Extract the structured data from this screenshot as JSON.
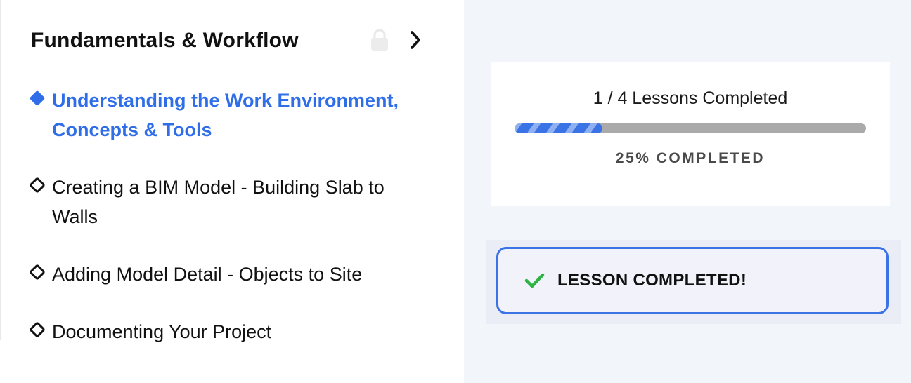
{
  "module": {
    "title": "Fundamentals & Workflow",
    "lock_icon": "lock-icon",
    "next_icon": "chevron-right-icon"
  },
  "lessons": [
    {
      "lines": [
        "Understanding the Work Environment,",
        "Concepts & Tools"
      ],
      "state": "active"
    },
    {
      "lines": [
        "Creating a BIM Model - Building Slab to",
        "Walls"
      ],
      "state": "incomplete"
    },
    {
      "lines": [
        "Adding Model Detail - Objects to Site"
      ],
      "state": "incomplete"
    },
    {
      "lines": [
        "Documenting Your Project"
      ],
      "state": "incomplete"
    }
  ],
  "progress": {
    "label": "1 / 4 Lessons Completed",
    "percent_label": "25% COMPLETED",
    "fraction": 0.25
  },
  "complete_button": {
    "label": "LESSON COMPLETED!",
    "icon": "checkmark-icon"
  },
  "colors": {
    "accent": "#2f6ee8",
    "check": "#2fb344",
    "track": "#aaaaaa"
  }
}
